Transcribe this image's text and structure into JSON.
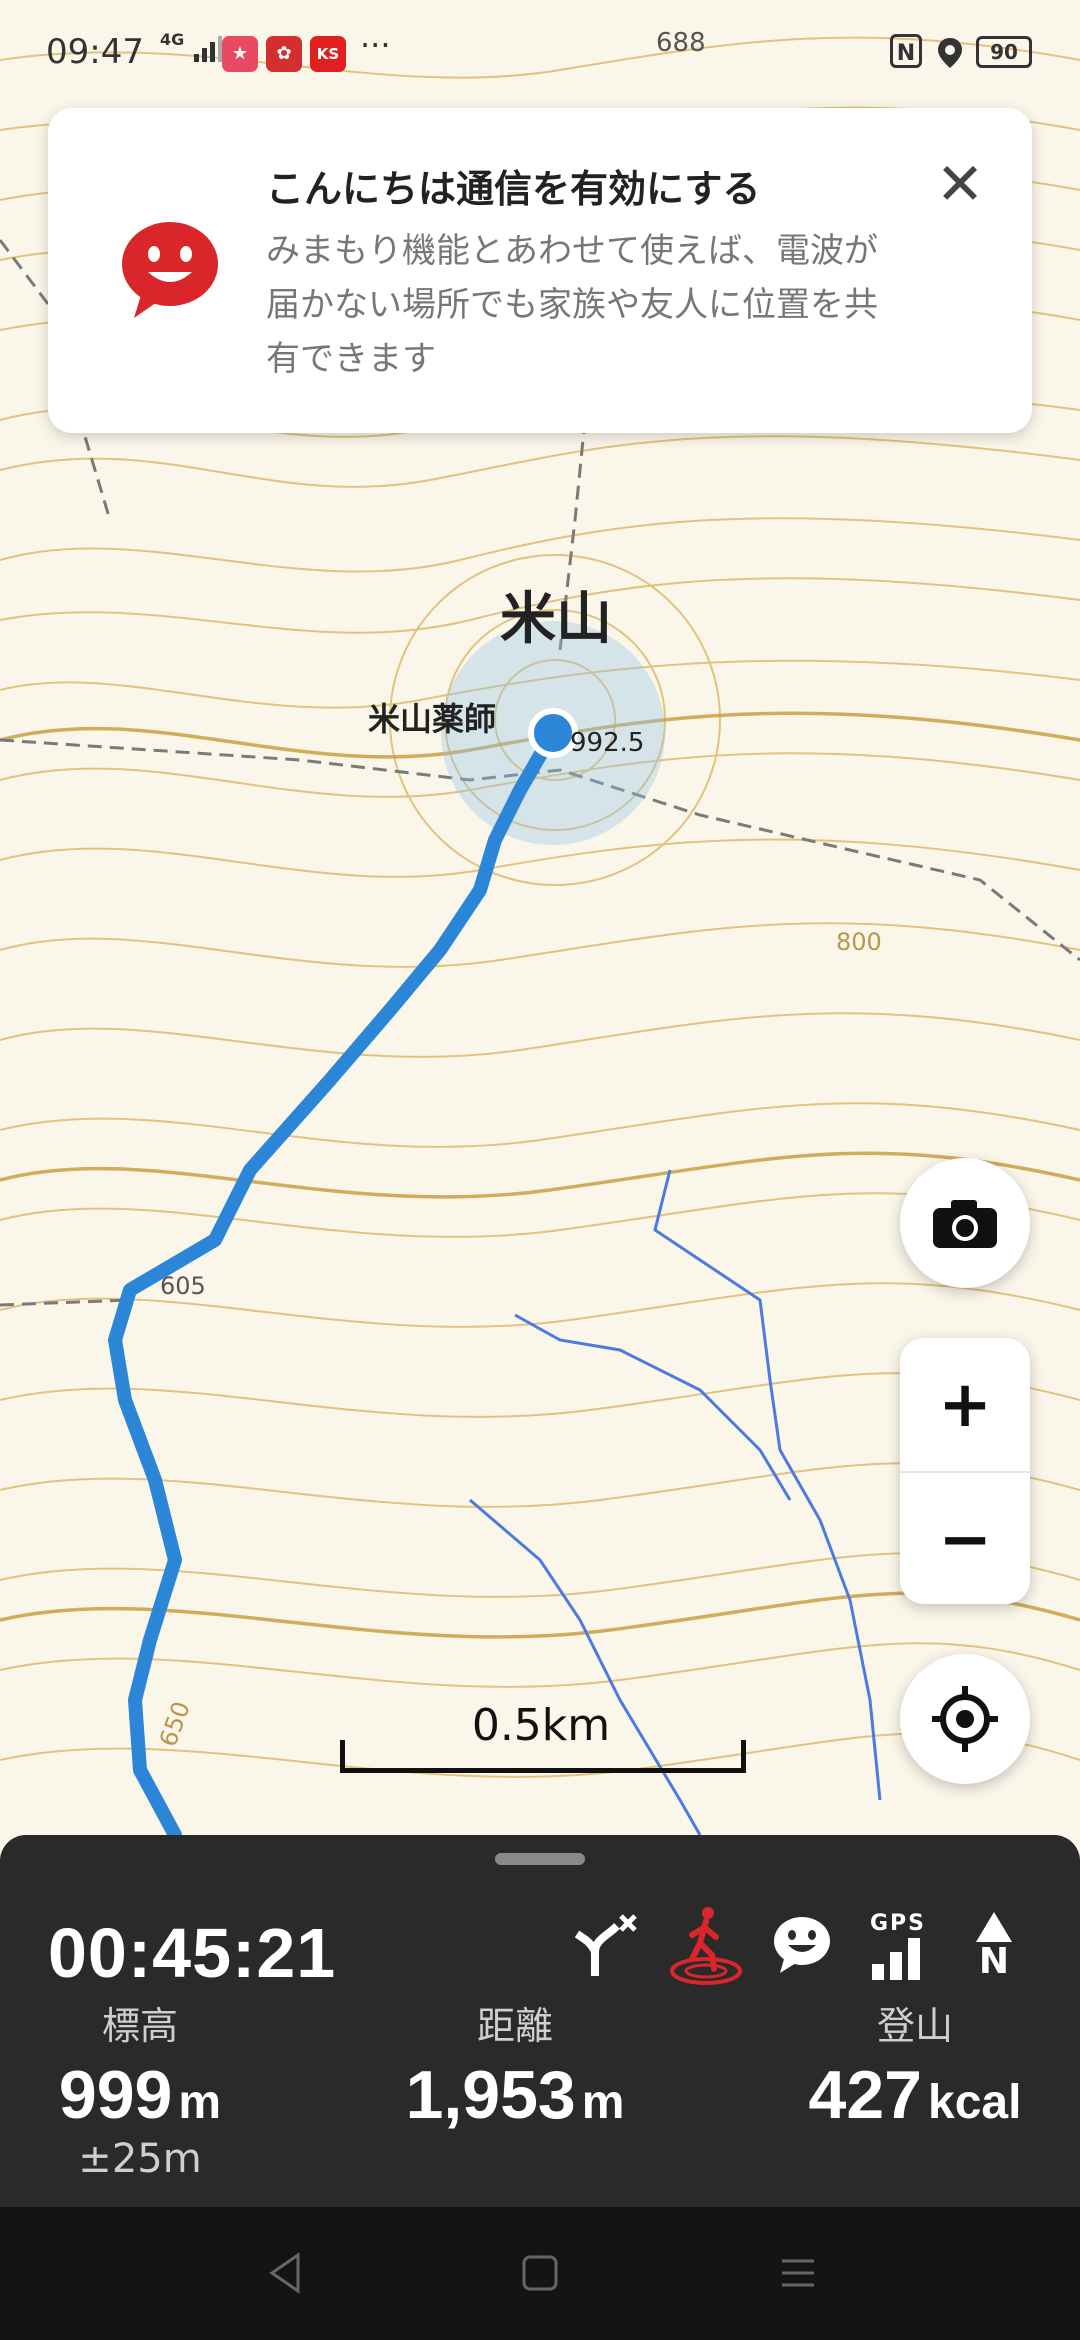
{
  "status_bar": {
    "time": "09:47",
    "network": "4G",
    "app_icons": [
      "★",
      "✿",
      "KS"
    ],
    "more": "···",
    "nfc": "N",
    "battery": "90"
  },
  "notification": {
    "title": "こんにちは通信を有効にする",
    "body": "みまもり機能とあわせて使えば、電波が届かない場所でも家族や友人に位置を共有できます",
    "close_label": "✕"
  },
  "map": {
    "labels": {
      "mountain": "米山",
      "shrine": "米山薬師",
      "summit_elev": "992.5",
      "contour_688": "688",
      "contour_605": "605",
      "contour_650": "650",
      "contour_800": "800"
    },
    "scale_label": "0.5km",
    "colors": {
      "track": "#2b86d8",
      "contour": "#d4a64a",
      "stream": "#4b7be0",
      "background": "#fbf6ea"
    }
  },
  "buttons": {
    "camera": "camera-icon",
    "zoom_in": "+",
    "zoom_out": "−",
    "locate": "crosshair-icon"
  },
  "panel": {
    "elapsed": "00:45:21",
    "stats": [
      {
        "label": "標高",
        "value": "999",
        "unit": "m",
        "sub": "±25m"
      },
      {
        "label": "距離",
        "value": "1,953",
        "unit": "m"
      },
      {
        "label": "登山",
        "value": "427",
        "unit": "kcal"
      }
    ],
    "gps_label": "GPS",
    "north_label": "N",
    "accent_color": "#d9262a"
  },
  "nav": {
    "back": "back-icon",
    "home": "home-icon",
    "menu": "menu-icon"
  }
}
